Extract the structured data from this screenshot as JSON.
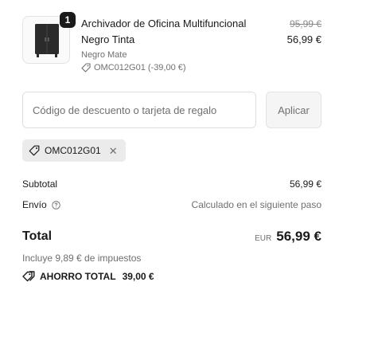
{
  "product": {
    "quantity": "1",
    "name": "Archivador de Oficina Multifuncional Negro Tinta",
    "variant": "Negro Mate",
    "discount_line": "OMC012G01 (-39,00 €)",
    "price_original": "95,99 €",
    "price_current": "56,99 €",
    "image_icon": "cabinet-image"
  },
  "discount": {
    "placeholder": "Código de descuento o tarjeta de regalo",
    "apply_label": "Aplicar",
    "applied_code": "OMC012G01"
  },
  "summary": {
    "subtotal_label": "Subtotal",
    "subtotal_value": "56,99 €",
    "shipping_label": "Envío",
    "shipping_value": "Calculado en el siguiente paso",
    "total_label": "Total",
    "currency": "EUR",
    "total_value": "56,99 €",
    "taxes_note": "Incluye 9,89 € de impuestos",
    "savings_label": "AHORRO TOTAL",
    "savings_value": "39,00 €"
  },
  "colors": {
    "text": "#1a1a1a",
    "muted": "#6f6f6f",
    "chip_bg": "#ebebeb",
    "border": "#dedede"
  }
}
